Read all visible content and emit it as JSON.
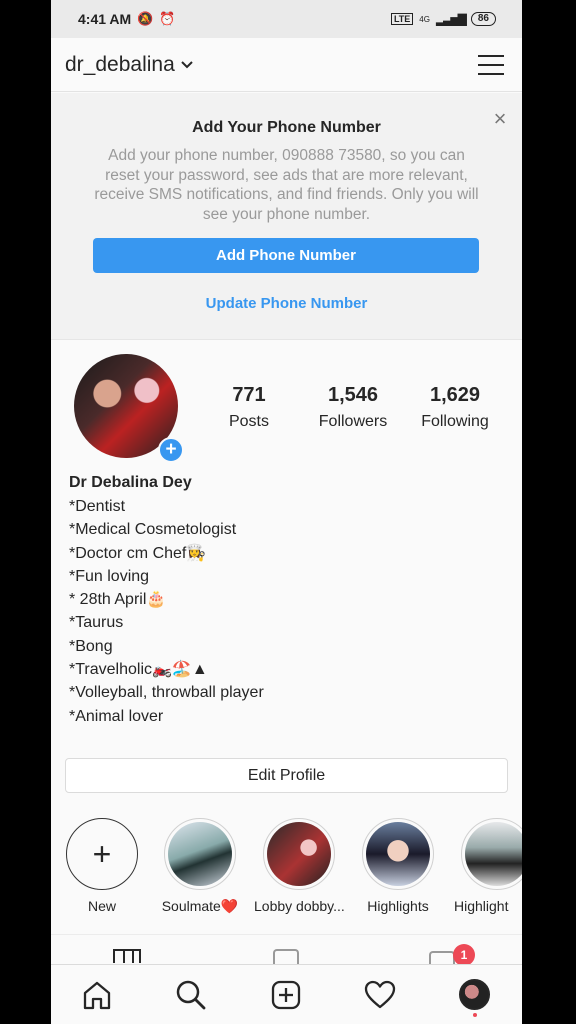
{
  "status_bar": {
    "time": "4:41 AM",
    "network": "4G",
    "battery": "86"
  },
  "header": {
    "username": "dr_debalina"
  },
  "phone_prompt": {
    "title": "Add Your Phone Number",
    "description": "Add your phone number, 090888 73580, so you can reset your password, see ads that are more relevant, receive SMS notifications, and find friends. Only you will see your phone number.",
    "primary_button": "Add Phone Number",
    "secondary_link": "Update Phone Number"
  },
  "stats": [
    {
      "value": "771",
      "label": "Posts"
    },
    {
      "value": "1,546",
      "label": "Followers"
    },
    {
      "value": "1,629",
      "label": "Following"
    }
  ],
  "bio": {
    "name": "Dr Debalina Dey",
    "lines": [
      "*Dentist",
      "*Medical Cosmetologist",
      "*Doctor cm Chef👩‍🍳",
      "*Fun loving",
      "* 28th April🎂",
      "*Taurus",
      "*Bong",
      "*Travelholic🏍️🏖️▲",
      "*Volleyball, throwball player",
      "*Animal lover"
    ]
  },
  "edit_profile_label": "Edit Profile",
  "highlights": [
    {
      "label": "New"
    },
    {
      "label": "Soulmate❤️"
    },
    {
      "label": "Lobby dobby..."
    },
    {
      "label": "Highlights"
    },
    {
      "label": "Highlight"
    }
  ],
  "notification_count": "1",
  "colors": {
    "accent": "#3897f0",
    "badge": "#ed4956",
    "text": "#262626"
  }
}
